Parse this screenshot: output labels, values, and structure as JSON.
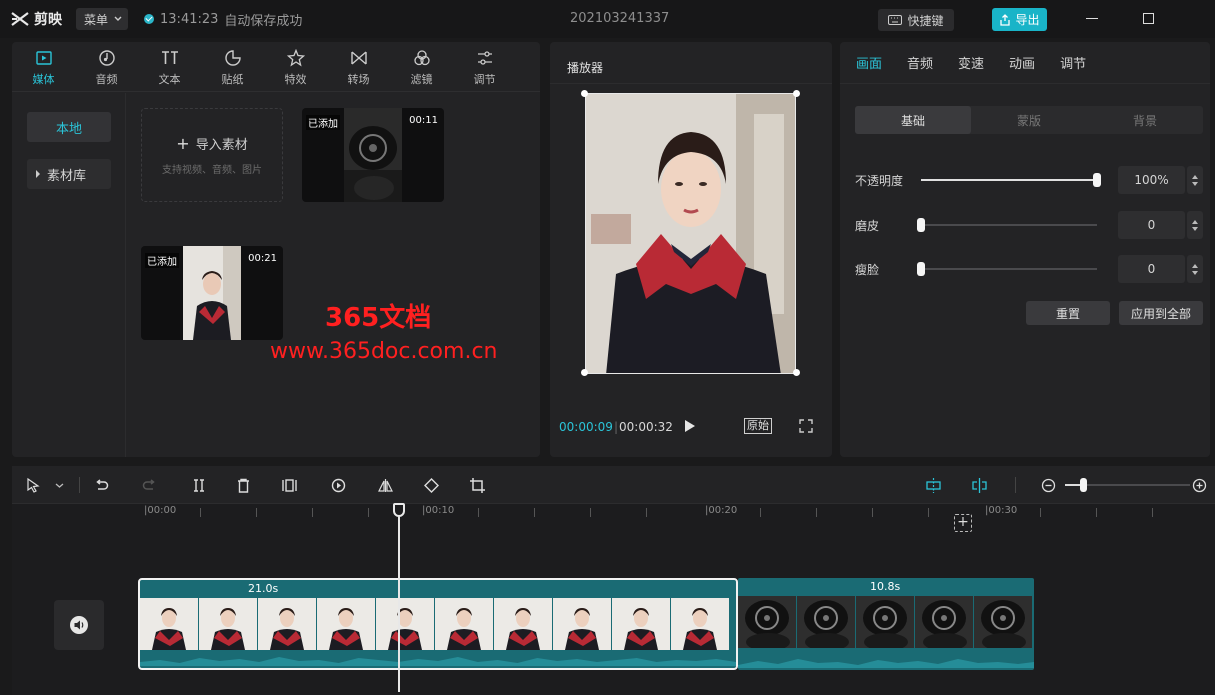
{
  "app": {
    "name": "剪映",
    "menu_label": "菜单",
    "save_time": "13:41:23",
    "save_status": "自动保存成功",
    "project_title": "202103241337",
    "shortcut_label": "快捷键",
    "export_label": "导出",
    "accent_color": "#2bc4d8"
  },
  "media_tabs": [
    {
      "label": "媒体",
      "icon": "media-icon",
      "active": true
    },
    {
      "label": "音频",
      "icon": "audio-icon"
    },
    {
      "label": "文本",
      "icon": "text-icon"
    },
    {
      "label": "贴纸",
      "icon": "sticker-icon"
    },
    {
      "label": "特效",
      "icon": "effects-icon"
    },
    {
      "label": "转场",
      "icon": "transition-icon"
    },
    {
      "label": "滤镜",
      "icon": "filter-icon"
    },
    {
      "label": "调节",
      "icon": "adjust-icon"
    }
  ],
  "media_sidebar": {
    "local": "本地",
    "library": "素材库"
  },
  "import": {
    "title": "导入素材",
    "subtitle": "支持视频、音频、图片"
  },
  "clips": [
    {
      "badge": "已添加",
      "duration": "00:11"
    },
    {
      "badge": "已添加",
      "duration": "00:21"
    }
  ],
  "player": {
    "title": "播放器",
    "current_time": "00:00:09",
    "total_time": "00:00:32",
    "original_label": "原始"
  },
  "props": {
    "tabs": [
      "画面",
      "音频",
      "变速",
      "动画",
      "调节"
    ],
    "segments": [
      "基础",
      "蒙版",
      "背景"
    ],
    "rows": [
      {
        "label": "不透明度",
        "value": "100%",
        "level": 1.0
      },
      {
        "label": "磨皮",
        "value": "0",
        "level": 0
      },
      {
        "label": "瘦脸",
        "value": "0",
        "level": 0
      }
    ],
    "reset_label": "重置",
    "apply_all_label": "应用到全部"
  },
  "timeline": {
    "ticks": [
      "|00:00",
      "|00:10",
      "|00:20",
      "|00:30"
    ],
    "clip1_duration": "21.0s",
    "clip2_duration": "10.8s"
  },
  "watermark": {
    "line1": "365文档",
    "line2": "www.365doc.com.cn"
  }
}
